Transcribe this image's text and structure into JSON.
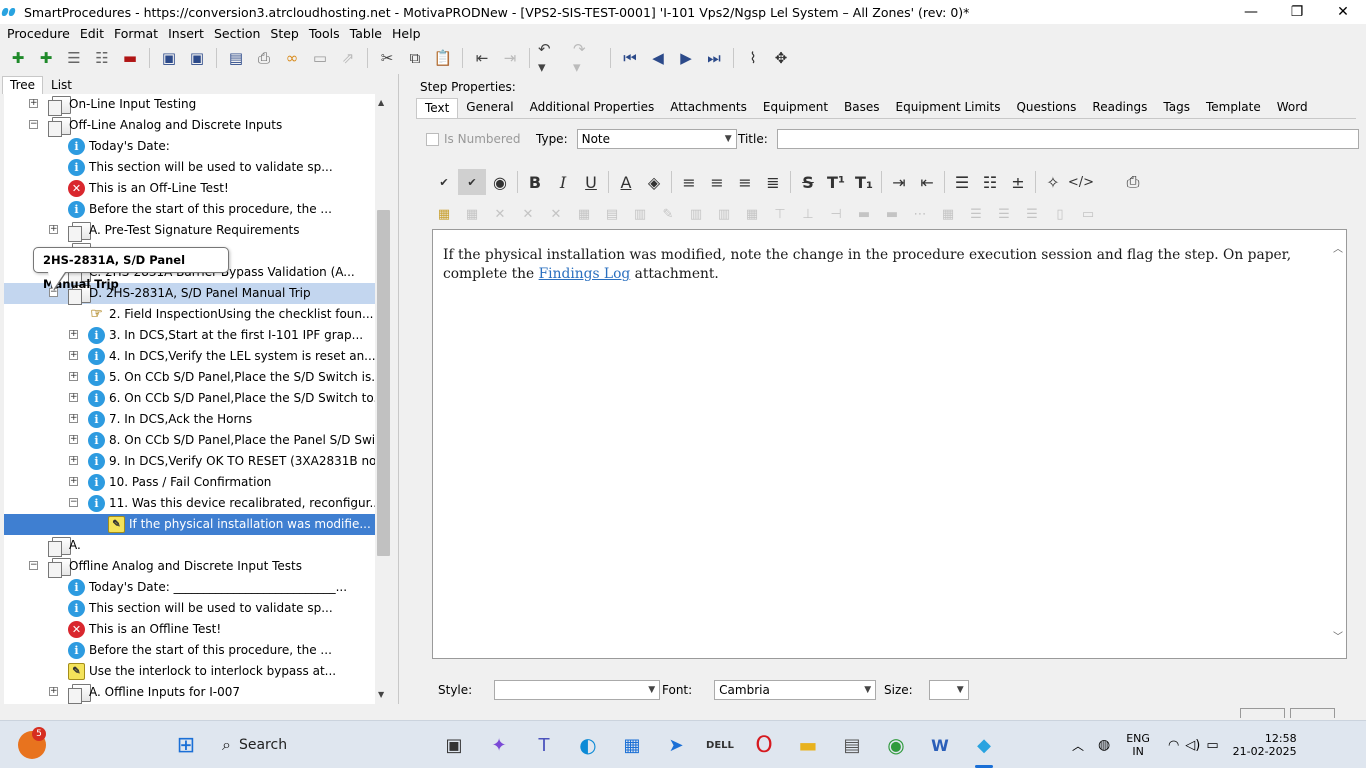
{
  "window": {
    "title": "SmartProcedures - https://conversion3.atrcloudhosting.net - MotivaPRODNew - [VPS2-SIS-TEST-0001] 'I-101 Vps2/Ngsp Lel System – All Zones' (rev: 0)*",
    "min": "—",
    "max": "❐",
    "close": "✕"
  },
  "menu": [
    "Procedure",
    "Edit",
    "Format",
    "Insert",
    "Section",
    "Step",
    "Tools",
    "Table",
    "Help"
  ],
  "left_tabs": {
    "tree": "Tree",
    "list": "List"
  },
  "tree": [
    {
      "label": "On-Line Input Testing",
      "indent": 1,
      "exp": "+",
      "icon": "sec"
    },
    {
      "label": "Off-Line Analog and Discrete Inputs",
      "indent": 1,
      "exp": "−",
      "icon": "sec"
    },
    {
      "label": "Today's Date:",
      "indent": 2,
      "icon": "info"
    },
    {
      "label": "This section will be used to validate sp...",
      "indent": 2,
      "icon": "info"
    },
    {
      "label": "This is an Off-Line Test!",
      "indent": 2,
      "icon": "err"
    },
    {
      "label": "Before the start of this procedure, the ...",
      "indent": 2,
      "icon": "info"
    },
    {
      "label": "A. Pre-Test Signature Requirements",
      "indent": 2,
      "exp": "+",
      "icon": "sec"
    },
    {
      "label": "",
      "indent": 2,
      "icon": "sec"
    },
    {
      "label": "C. 2HS-2831A Barrier Bypass Validation (A...",
      "indent": 2,
      "exp": "+",
      "icon": "sec"
    },
    {
      "label": "D. 2HS-2831A, S/D Panel Manual Trip",
      "indent": 2,
      "exp": "−",
      "icon": "sec",
      "state": "hl"
    },
    {
      "label": "2. Field InspectionUsing the checklist foun...",
      "indent": 3,
      "icon": "hand"
    },
    {
      "label": "3. In DCS,Start at the first I-101 IPF grap...",
      "indent": 3,
      "exp": "+",
      "icon": "info"
    },
    {
      "label": "4. In DCS,Verify the LEL system is reset an...",
      "indent": 3,
      "exp": "+",
      "icon": "info"
    },
    {
      "label": "5. On CCb S/D Panel,Place the S/D Switch is...",
      "indent": 3,
      "exp": "+",
      "icon": "info"
    },
    {
      "label": "6. On CCb S/D Panel,Place the S/D Switch to...",
      "indent": 3,
      "exp": "+",
      "icon": "info"
    },
    {
      "label": "7. In DCS,Ack the Horns",
      "indent": 3,
      "exp": "+",
      "icon": "info"
    },
    {
      "label": "8. On CCb S/D Panel,Place the Panel S/D Swi...",
      "indent": 3,
      "exp": "+",
      "icon": "info"
    },
    {
      "label": "9. In DCS,Verify OK TO RESET (3XA2831B not ...",
      "indent": 3,
      "exp": "+",
      "icon": "info"
    },
    {
      "label": "10. Pass / Fail Confirmation",
      "indent": 3,
      "exp": "+",
      "icon": "info"
    },
    {
      "label": "11. Was this device recalibrated, reconfigur...",
      "indent": 3,
      "exp": "−",
      "icon": "info"
    },
    {
      "label": "If the physical installation was modifie...",
      "indent": 4,
      "icon": "note",
      "state": "sel"
    },
    {
      "label": "A.",
      "indent": 1,
      "icon": "sec"
    },
    {
      "label": "Offline Analog and Discrete Input Tests",
      "indent": 1,
      "exp": "−",
      "icon": "sec"
    },
    {
      "label": "Today's Date: ___________________________...",
      "indent": 2,
      "icon": "info"
    },
    {
      "label": "This section will be used to validate sp...",
      "indent": 2,
      "icon": "info"
    },
    {
      "label": "This is an Offline Test!",
      "indent": 2,
      "icon": "err"
    },
    {
      "label": "Before the start of this procedure, the ...",
      "indent": 2,
      "icon": "info"
    },
    {
      "label": "Use the interlock to interlock bypass at...",
      "indent": 2,
      "icon": "note"
    },
    {
      "label": "A. Offline Inputs for I-007",
      "indent": 2,
      "exp": "+",
      "icon": "sec"
    }
  ],
  "tooltip": "2HS-2831A, S/D Panel Manual Trip",
  "step_properties": {
    "heading": "Step Properties:",
    "tabs": [
      "Text",
      "General",
      "Additional Properties",
      "Attachments",
      "Equipment",
      "Bases",
      "Equipment Limits",
      "Questions",
      "Readings",
      "Tags",
      "Template",
      "Word"
    ],
    "is_numbered": "Is Numbered",
    "type_label": "Type:",
    "type_value": "Note",
    "title_label": "Title:",
    "title_value": "",
    "text_before": "If the physical installation was modified, note the change in the procedure execution session and flag the step. On paper, complete the ",
    "link": "Findings Log",
    "text_after": " attachment.",
    "style_label": "Style:",
    "style_value": "",
    "font_label": "Font:",
    "font_value": "Cambria",
    "size_label": "Size:",
    "size_value": ""
  },
  "taskbar": {
    "search": "Search",
    "notif_count": "5",
    "lang1": "ENG",
    "lang2": "IN",
    "time": "12:58",
    "date": "21-02-2025"
  }
}
